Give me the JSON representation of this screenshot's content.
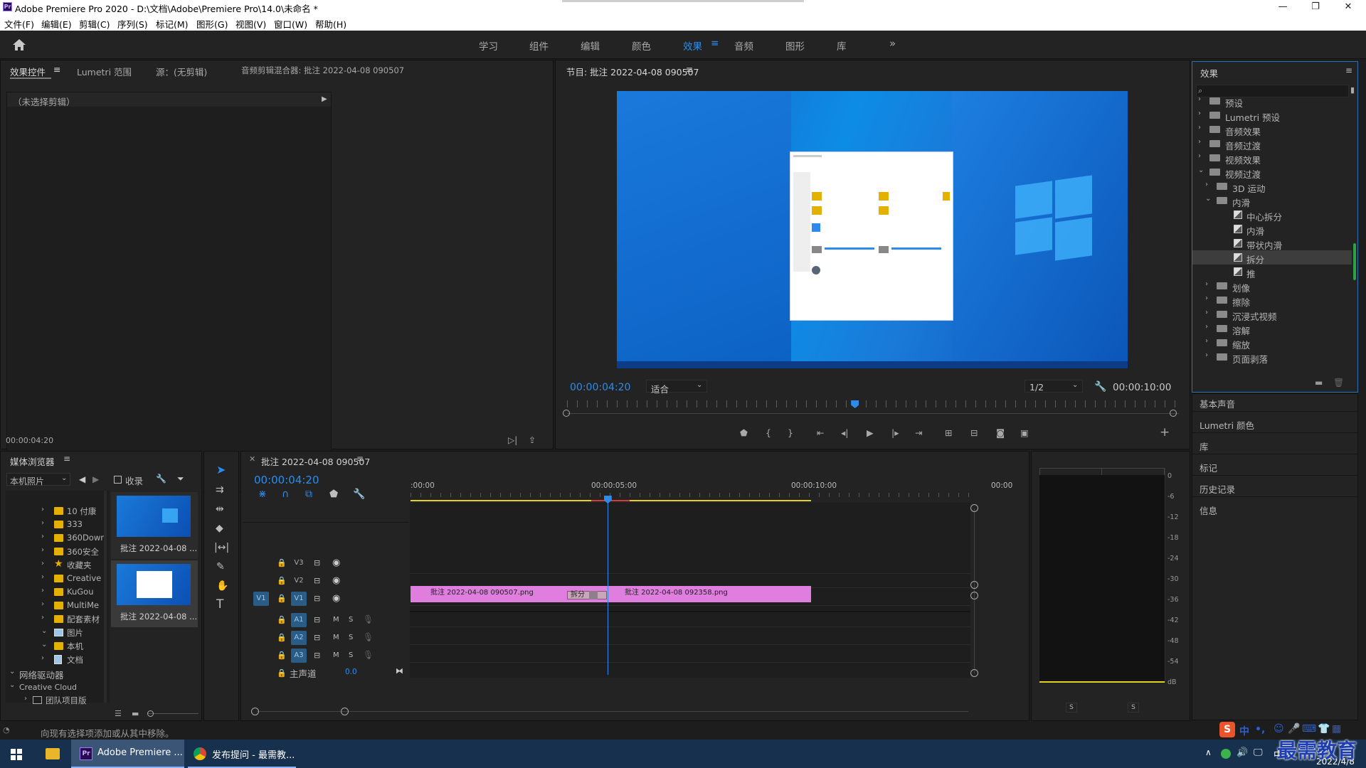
{
  "window": {
    "title": "Adobe Premiere Pro 2020 - D:\\文档\\Adobe\\Premiere Pro\\14.0\\未命名 *",
    "app_icon": "Pr",
    "minimize": "—",
    "maximize": "❐",
    "close": "✕"
  },
  "menu": [
    "文件(F)",
    "编辑(E)",
    "剪辑(C)",
    "序列(S)",
    "标记(M)",
    "图形(G)",
    "视图(V)",
    "窗口(W)",
    "帮助(H)"
  ],
  "workspaces": {
    "items": [
      "学习",
      "组件",
      "编辑",
      "颜色",
      "效果",
      "音频",
      "图形",
      "库"
    ],
    "active": "效果",
    "more": "»"
  },
  "effect_controls": {
    "tabs": [
      "效果控件",
      "Lumetri 范围",
      "源：(无剪辑)",
      "音频剪辑混合器: 批注 2022-04-08 090507"
    ],
    "no_clip": "（未选择剪辑）",
    "timecode": "00:00:04:20"
  },
  "program_monitor": {
    "title": "节目: 批注 2022-04-08 090507",
    "timecode": "00:00:04:20",
    "fit": "适合",
    "resolution": "1/2",
    "duration": "00:00:10:00",
    "playhead_fraction": 0.47
  },
  "effects_panel": {
    "title": "效果",
    "search_placeholder": "",
    "items": [
      {
        "label": "预设",
        "level": 0,
        "state": "collapsed",
        "icon": "preset-folder"
      },
      {
        "label": "Lumetri 预设",
        "level": 0,
        "state": "collapsed",
        "icon": "preset-folder"
      },
      {
        "label": "音频效果",
        "level": 0,
        "state": "collapsed",
        "icon": "folder"
      },
      {
        "label": "音频过渡",
        "level": 0,
        "state": "collapsed",
        "icon": "folder"
      },
      {
        "label": "视频效果",
        "level": 0,
        "state": "collapsed",
        "icon": "folder"
      },
      {
        "label": "视频过渡",
        "level": 0,
        "state": "expanded",
        "icon": "folder"
      },
      {
        "label": "3D 运动",
        "level": 1,
        "state": "collapsed",
        "icon": "folder"
      },
      {
        "label": "内滑",
        "level": 1,
        "state": "expanded",
        "icon": "folder"
      },
      {
        "label": "中心拆分",
        "level": 2,
        "state": "leaf",
        "icon": "transition"
      },
      {
        "label": "内滑",
        "level": 2,
        "state": "leaf",
        "icon": "transition"
      },
      {
        "label": "带状内滑",
        "level": 2,
        "state": "leaf",
        "icon": "transition"
      },
      {
        "label": "拆分",
        "level": 2,
        "state": "selected",
        "icon": "transition"
      },
      {
        "label": "推",
        "level": 2,
        "state": "leaf",
        "icon": "transition"
      },
      {
        "label": "划像",
        "level": 1,
        "state": "collapsed",
        "icon": "folder"
      },
      {
        "label": "擦除",
        "level": 1,
        "state": "collapsed",
        "icon": "folder"
      },
      {
        "label": "沉浸式视频",
        "level": 1,
        "state": "collapsed",
        "icon": "folder"
      },
      {
        "label": "溶解",
        "level": 1,
        "state": "collapsed",
        "icon": "folder"
      },
      {
        "label": "缩放",
        "level": 1,
        "state": "collapsed",
        "icon": "folder"
      },
      {
        "label": "页面剥落",
        "level": 1,
        "state": "collapsed",
        "icon": "folder"
      }
    ]
  },
  "side_panels": [
    "基本声音",
    "Lumetri 颜色",
    "库",
    "标记",
    "历史记录",
    "信息"
  ],
  "media_browser": {
    "title": "媒体浏览器",
    "location": "本机照片",
    "favorites_label": "收录",
    "tree": [
      {
        "label": "10 付康",
        "icon": "folder-yellow"
      },
      {
        "label": "333",
        "icon": "folder-yellow"
      },
      {
        "label": "360Dowr",
        "icon": "folder-yellow"
      },
      {
        "label": "360安全",
        "icon": "folder-yellow"
      },
      {
        "label": "收藏夹",
        "icon": "star"
      },
      {
        "label": "Creative",
        "icon": "folder-yellow"
      },
      {
        "label": "KuGou",
        "icon": "folder-yellow"
      },
      {
        "label": "MultiMe",
        "icon": "folder-yellow"
      },
      {
        "label": "配套素材",
        "icon": "folder-yellow"
      },
      {
        "label": "图片",
        "icon": "picture"
      },
      {
        "label": "本机",
        "icon": "folder-yellow"
      },
      {
        "label": "文档",
        "icon": "document"
      },
      {
        "label": "网络驱动器",
        "icon": "none"
      },
      {
        "label": "Creative Cloud",
        "icon": "none"
      },
      {
        "label": "团队项目版",
        "icon": "team"
      }
    ],
    "thumbs": [
      "批注 2022-04-08 ...",
      "批注 2022-04-08 ..."
    ]
  },
  "timeline": {
    "title": "批注 2022-04-08 090507",
    "timecode": "00:00:04:20",
    "ruler": [
      ":00:00",
      "00:00:05:00",
      "00:00:10:00",
      "00:00"
    ],
    "video_tracks": [
      "V3",
      "V2",
      "V1"
    ],
    "audio_tracks": [
      "A1",
      "A2",
      "A3"
    ],
    "source_patch": "V1",
    "track_buttons": {
      "mute": "M",
      "solo": "S"
    },
    "master": {
      "label": "主声道",
      "value": "0.0"
    },
    "clips": [
      "批注 2022-04-08 090507.png",
      "批注 2022-04-08 092358.png"
    ],
    "transition": "拆分",
    "playhead_seconds": 4.8
  },
  "audio_meter": {
    "scale": [
      "0",
      "-6",
      "-12",
      "-18",
      "-24",
      "-30",
      "-36",
      "-42",
      "-48",
      "-54",
      "dB"
    ],
    "solo": [
      "S",
      "S"
    ]
  },
  "status": "向现有选择项添加或从其中移除。",
  "taskbar": {
    "apps": [
      "Adobe Premiere ...",
      "发布提问 - 最需教..."
    ],
    "ime": [
      "中",
      "•,"
    ],
    "watermark": "最需教育",
    "date": "2022/4/8"
  },
  "colors": {
    "accent": "#2d8ceb",
    "clip": "#df7edf",
    "work_area": "#e5d120",
    "panel_bg": "#232323",
    "taskbar": "#16304d"
  }
}
